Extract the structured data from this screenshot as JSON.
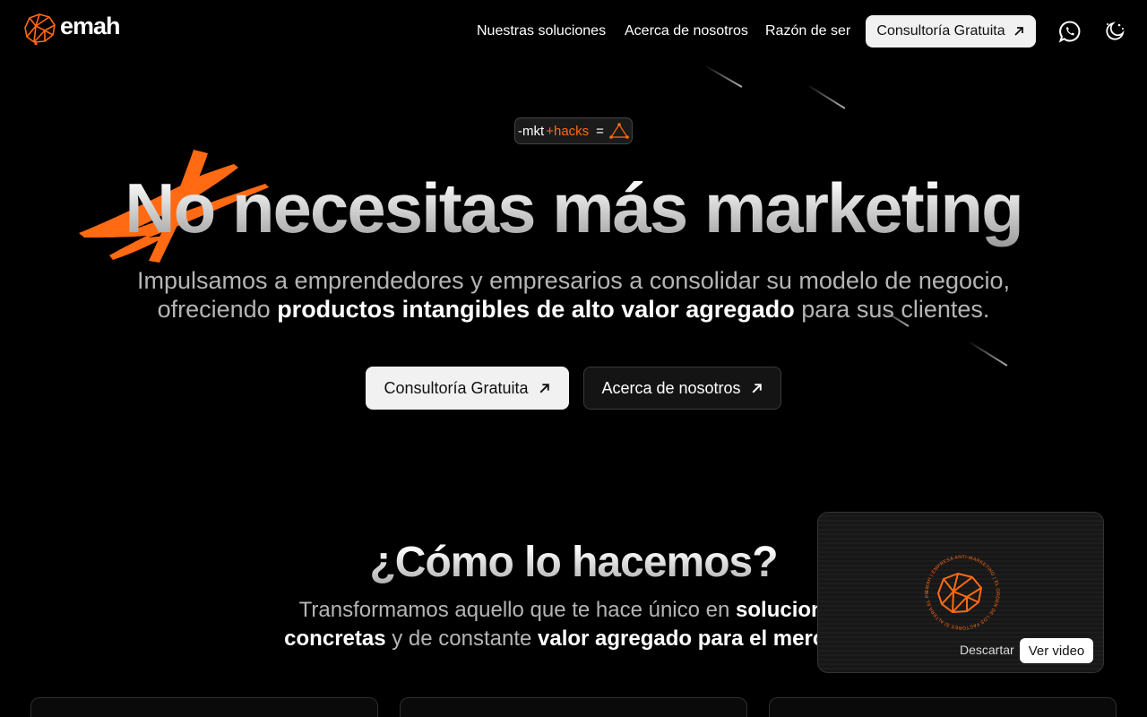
{
  "brand": {
    "name": "emah",
    "accent": "#ff6a13"
  },
  "nav": {
    "links": [
      "Nuestras soluciones",
      "Acerca de nosotros",
      "Razón de ser"
    ],
    "cta": "Consultoría Gratuita",
    "icons": [
      "whatsapp-icon",
      "theme-toggle-icon"
    ]
  },
  "hero": {
    "badge": {
      "minus": "-mkt",
      "plus": "+hacks",
      "eq": "="
    },
    "title": "No necesitas más marketing",
    "subtitle_pre": "Impulsamos a emprendedores y empresarios a consolidar su modelo de negocio, ofreciendo ",
    "subtitle_strong": "productos intangibles de alto valor agregado",
    "subtitle_post": " para sus clientes.",
    "primary_button": "Consultoría Gratuita",
    "secondary_button": "Acerca de nosotros"
  },
  "how": {
    "title": "¿Cómo lo hacemos?",
    "sub_pre": "Transformamos aquello que te hace único en ",
    "sub_strong1": "soluciones concretas",
    "sub_mid": " y de constante ",
    "sub_strong2": "valor agregado para el mercado"
  },
  "video_popup": {
    "seal_text": "EMAH | EMPRESA ANTI-MARKETING | EL ORDEN DE LOS FACTORES SÍ ALTERA EL PRODUCTO |",
    "dismiss": "Descartar",
    "watch": "Ver video"
  }
}
